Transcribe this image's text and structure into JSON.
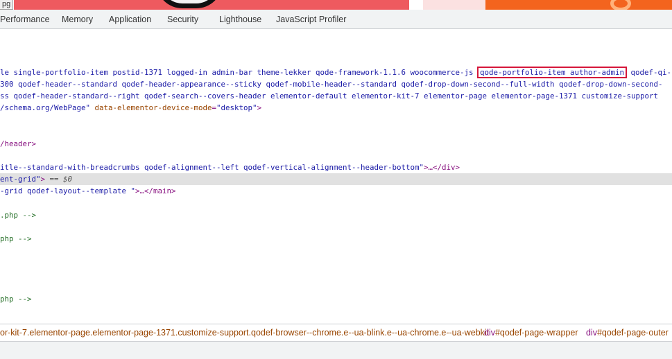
{
  "preview": {
    "file_tag": "pg"
  },
  "tabs": [
    "Performance",
    "Memory",
    "Application",
    "Security",
    "Lighthouse",
    "JavaScript Profiler"
  ],
  "code": {
    "line1": {
      "pre": "le single-portfolio-item postid-1371 logged-in admin-bar theme-lekker qode-framework-1.1.6 woocommerce-js ",
      "highlight": "qode-portfolio-item author-admin",
      "post": " qodef-qi-"
    },
    "line2": "300 qodef-header--standard qodef-header-appearance--sticky qodef-mobile-header--standard qodef-drop-down-second--full-width qodef-drop-down-second-",
    "line3": "ss qodef-header-standard--right qodef-search--covers-header elementor-default elementor-kit-7 elementor-page elementor-page-1371 customize-support",
    "line4": {
      "val": "/schema.org/WebPage\"",
      "attr": " data-elementor-device-mode",
      "eq": "=",
      "val2": "\"desktop\"",
      "close": ">"
    },
    "line5": "/header>",
    "line6": {
      "val": "itle--standard-with-breadcrumbs qodef-alignment--left qodef-vertical-alignment--header-bottom\"",
      "rest": ">…</div>"
    },
    "line7": {
      "val": "ent-grid\"",
      "close": ">",
      "eq": " == $0"
    },
    "line8": {
      "val": "-grid qodef-layout--template \"",
      "rest": ">…</main>"
    },
    "line9": ".php -->",
    "line10": "php -->",
    "line11": "php -->"
  },
  "breadcrumbs": {
    "long": "or-kit-7.elementor-page.elementor-page-1371.customize-support.qodef-browser--chrome.e--ua-blink.e--ua-chrome.e--ua-webkit",
    "item1_tag": "div",
    "item1_id": "#qodef-page-wrapper",
    "item2_tag": "div",
    "item2_id": "#qodef-page-outer"
  },
  "colors": {
    "tag": "#881280",
    "attr": "#994500",
    "value": "#1a1aa6",
    "comment": "#236e25",
    "highlight_border": "#d6163a",
    "selected_row": "#e1e1e1"
  }
}
